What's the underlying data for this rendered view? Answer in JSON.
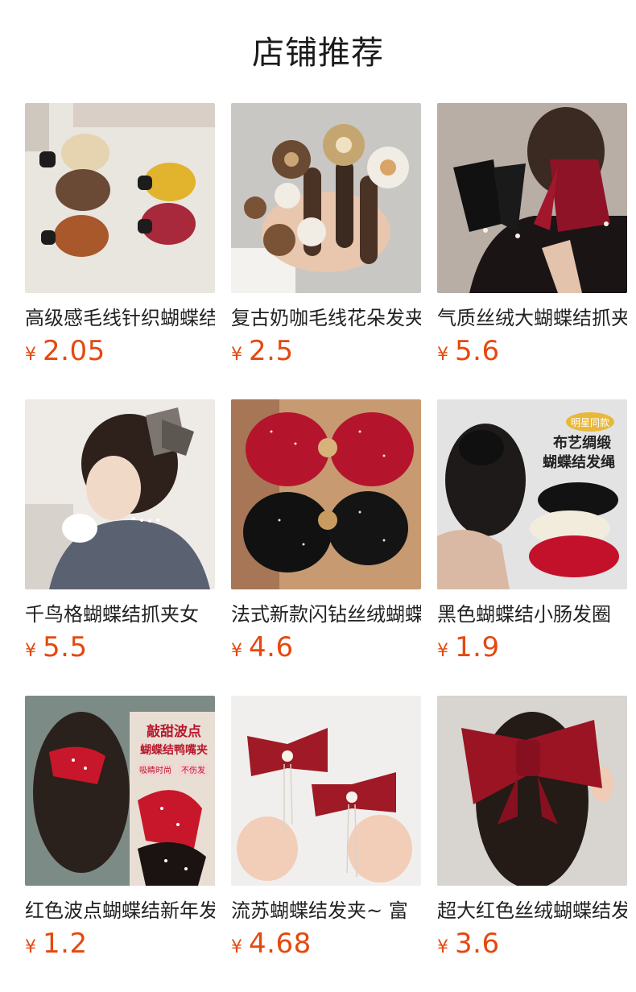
{
  "header": {
    "title": "店铺推荐"
  },
  "currency": "¥",
  "products": [
    {
      "name": "高级感毛线针织蝴蝶结抓夹",
      "price": "2.05",
      "thumb": "knit-bow-claw-clips"
    },
    {
      "name": "复古奶咖毛线花朵发夹",
      "price": "2.5",
      "thumb": "knit-flower-hair-clips"
    },
    {
      "name": "气质丝绒大蝴蝶结抓夹",
      "price": "5.6",
      "thumb": "velvet-ribbon-bow"
    },
    {
      "name": "千鸟格蝴蝶结抓夹女",
      "price": "5.5",
      "thumb": "houndstooth-bow-claw"
    },
    {
      "name": "法式新款闪钻丝绒蝴蝶结",
      "price": "4.6",
      "thumb": "rhinestone-velvet-bows"
    },
    {
      "name": "黑色蝴蝶结小肠发圈",
      "price": "1.9",
      "thumb": "bow-scrunchies"
    },
    {
      "name": "红色波点蝴蝶结新年发夹",
      "price": "1.2",
      "thumb": "polka-dot-bow-clip"
    },
    {
      "name": "流苏蝴蝶结发夹~ 富",
      "price": "4.68",
      "thumb": "tassel-bow-clips"
    },
    {
      "name": "超大红色丝绒蝴蝶结发夹",
      "price": "3.6",
      "thumb": "oversized-red-bow"
    }
  ],
  "thumb_texts": {
    "scrunchie_badge": "明星同款",
    "scrunchie_line1": "布艺绸缎",
    "scrunchie_line2": "蝴蝶结发绳",
    "polka_line1": "敲甜波点",
    "polka_line2": "蝴蝶结鸭嘴夹",
    "polka_tag1": "吸睛时尚",
    "polka_tag2": "不伤发"
  },
  "colors": {
    "price": "#e4490f",
    "title": "#1a1a1a",
    "text": "#222222"
  }
}
